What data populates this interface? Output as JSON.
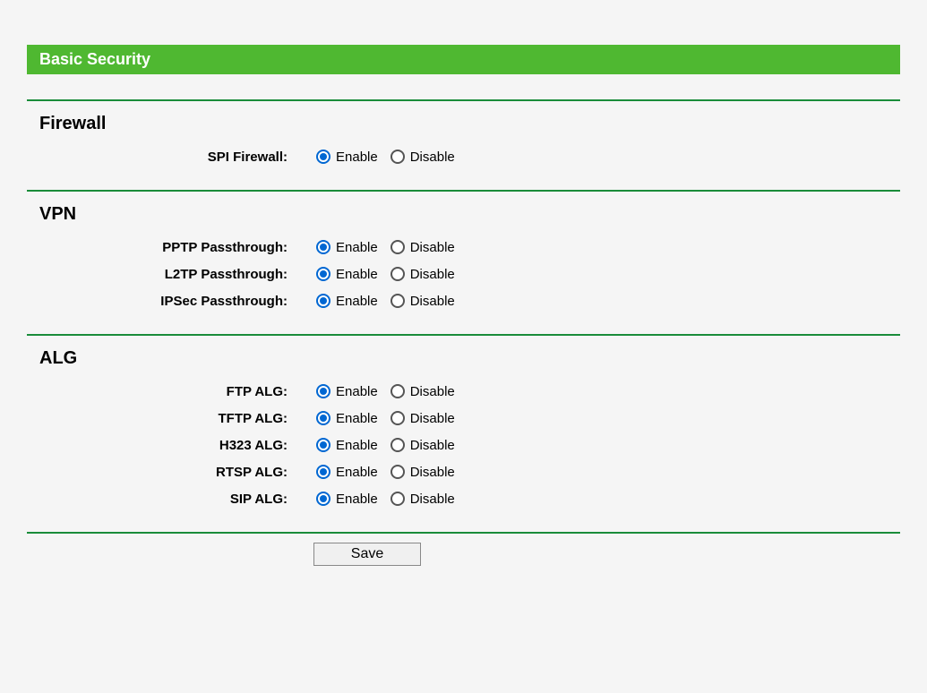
{
  "page_title": "Basic Security",
  "options": {
    "enable": "Enable",
    "disable": "Disable"
  },
  "sections": {
    "firewall": {
      "title": "Firewall",
      "spi_firewall_label": "SPI Firewall:",
      "spi_firewall_value": "enable"
    },
    "vpn": {
      "title": "VPN",
      "pptp_label": "PPTP Passthrough:",
      "pptp_value": "enable",
      "l2tp_label": "L2TP Passthrough:",
      "l2tp_value": "enable",
      "ipsec_label": "IPSec Passthrough:",
      "ipsec_value": "enable"
    },
    "alg": {
      "title": "ALG",
      "ftp_label": "FTP ALG:",
      "ftp_value": "enable",
      "tftp_label": "TFTP ALG:",
      "tftp_value": "enable",
      "h323_label": "H323 ALG:",
      "h323_value": "enable",
      "rtsp_label": "RTSP ALG:",
      "rtsp_value": "enable",
      "sip_label": "SIP ALG:",
      "sip_value": "enable"
    }
  },
  "save_label": "Save"
}
